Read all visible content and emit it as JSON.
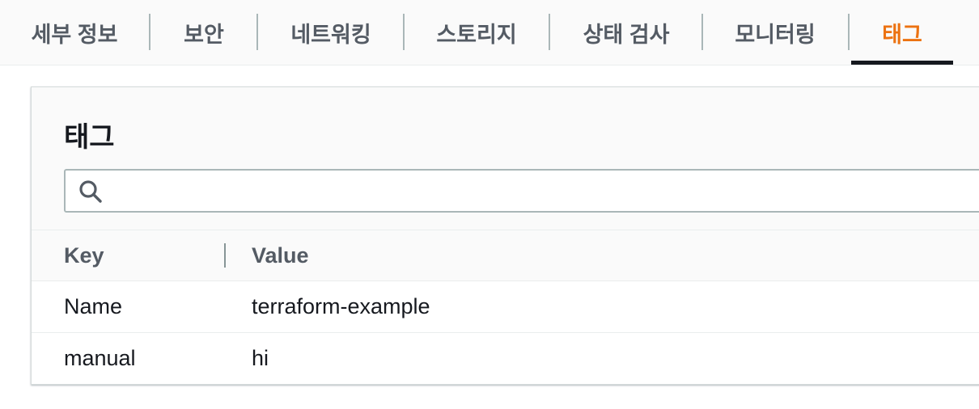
{
  "tabs": [
    {
      "label": "세부 정보",
      "active": false
    },
    {
      "label": "보안",
      "active": false
    },
    {
      "label": "네트워킹",
      "active": false
    },
    {
      "label": "스토리지",
      "active": false
    },
    {
      "label": "상태 검사",
      "active": false
    },
    {
      "label": "모니터링",
      "active": false
    },
    {
      "label": "태그",
      "active": true
    }
  ],
  "colors": {
    "active_tab": "#ec7211",
    "tab_text": "#545b64",
    "text": "#16191f"
  },
  "panel": {
    "title": "태그",
    "search": {
      "value": "",
      "placeholder": "",
      "icon": "search-icon"
    },
    "table": {
      "columns": [
        "Key",
        "Value"
      ],
      "rows": [
        {
          "key": "Name",
          "value": "terraform-example"
        },
        {
          "key": "manual",
          "value": "hi"
        }
      ]
    }
  }
}
